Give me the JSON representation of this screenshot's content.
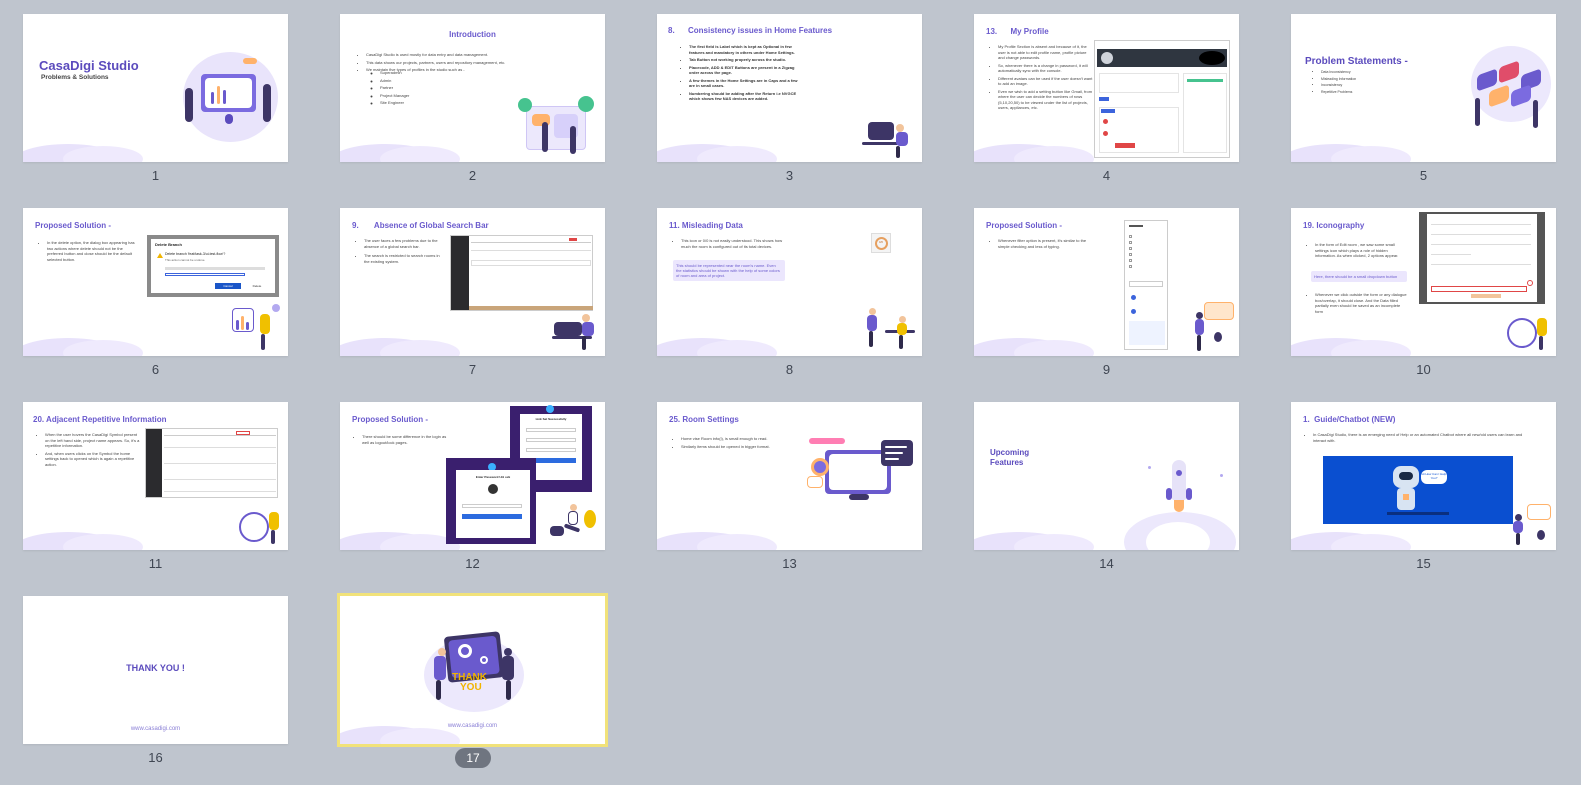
{
  "slides": [
    {
      "n": "1",
      "title": "CasaDigi Studio",
      "subtitle": "Problems & Solutions"
    },
    {
      "n": "2",
      "title": "Introduction",
      "bullets": [
        "CasaDigi Studio is used mostly for data entry and data management.",
        "This data shows our projects, partners, users and repository management, etc.",
        "We maintain five types of profiles in the studio such as -"
      ],
      "sub": [
        "Superadmin",
        "Admin",
        "Partner",
        "Project Manager",
        "Site Engineer"
      ]
    },
    {
      "n": "3",
      "title": "8.      Consistency issues in Home Features",
      "bullets": [
        "The first field is Label which is kept as Optional in few features and mandatory in others under Home Settings.",
        "Tab Button not working properly across the studio.",
        "Placecode, ADD & EDIT Buttons are present in a Zigzag order across the page.",
        "A few themes in the Home Settings are in Caps and a few are in small cases.",
        "Numbering should be adding after the Return i.e NVGCE which shows few NAS devices are added."
      ]
    },
    {
      "n": "4",
      "title": "13.      My Profile",
      "bullets": [
        "My Profile Section is absent and because of it, the user is not able to edit profile name, profile picture and change passwords.",
        "So, whenever there is a change in password, it will automatically sync with the console.",
        "Different avatars can be used if the user doesn't want to add an image.",
        "Even we wish to add a setting button like Gmail, from where the user can decide the numbers of rows (5,10,20,50) to be viewed under the list of projects, users, appliances, etc."
      ]
    },
    {
      "n": "5",
      "title": "Problem Statements -",
      "bullets": [
        "Data Inconsistency",
        "Misleading Information",
        "Inconsistency",
        "Repetitive Problems"
      ]
    },
    {
      "n": "6",
      "title": "Proposed Solution -",
      "bullets": [
        "In the delete option, the dialog box appearing has two actions where delete should not be the preferred button and close should be the default selected button."
      ],
      "dialog_title": "Delete Branch",
      "dialog_q": "Delete branch 'feat/task-3/ui-test-flow'?",
      "dialog_sub": "This action cannot be undone.",
      "dialog_cancel": "Cancel",
      "dialog_delete": "Delete"
    },
    {
      "n": "7",
      "title": "9.       Absence of Global Search Bar",
      "bullets": [
        "The user faces a few problems due to the absence of a global search bar.",
        "The search is restricted to search rooms in the existing system."
      ]
    },
    {
      "n": "8",
      "title": "11. Misleading Data",
      "bullets": [
        "This icon or 0/0 is not easily understood. This shows how much the room is configured out of its total devices."
      ],
      "note": "This should be represented near the room's name. Even the statistics should be shown with the help of some colors of room and area of project.",
      "badge": "0/0"
    },
    {
      "n": "9",
      "title": "Proposed Solution -",
      "bullets": [
        "Whenever filter option is present, it's similar to the simple checking and less of typing."
      ]
    },
    {
      "n": "10",
      "title": "19. Iconography",
      "bullets": [
        "In the form of Edit room , we saw some small settings icon which plays a role of hidden information. As when clicked, 2 options appear."
      ],
      "note": "Here, there should be a small dropdown button",
      "bullets2": [
        "Whenever we click outside the form or any dialogue box/overlap, it should close. And the Data filled partially even should be saved as an incomplete form"
      ]
    },
    {
      "n": "11",
      "title": "20. Adjacent Repetitive Information",
      "bullets": [
        "When the user hovers the CasaDigi Symbol present on the left hand side, project name appears. So, it's a repetitive information.",
        "And, when users clicks on the Symbol the home settings back to opened which is again a repetitive action."
      ]
    },
    {
      "n": "12",
      "title": "Proposed Solution -",
      "bullets": [
        "There should be some difference in the login as well as logout/lock pages."
      ],
      "card1": "Link Set Successfully",
      "card2": "Enter Password Unl ock"
    },
    {
      "n": "13",
      "title": "25. Room Settings",
      "bullets": [
        "Home vise Room info(i), is small enough to read.",
        "Similarly items should be opened in bigger format."
      ]
    },
    {
      "n": "14",
      "title": "Upcoming",
      "title2": "Features"
    },
    {
      "n": "15",
      "title": "1.  Guide/Chatbot (NEW)",
      "bullets": [
        "In CasaDigi Studio, there is an emerging need of Help or an automated Chatbot where all new/old users can learn and interact with."
      ],
      "bubble": "Hi How Can I Help You?"
    },
    {
      "n": "16",
      "title": "THANK YOU !",
      "url": "www.casadigi.com"
    },
    {
      "n": "17",
      "title": "THANK",
      "title2": "YOU",
      "url": "www.casadigi.com"
    }
  ],
  "colors": {
    "accent": "#6a5acd",
    "lavender": "#e8e2fb",
    "canvas": "#bfc5ce",
    "selected": "#f1e27a"
  }
}
